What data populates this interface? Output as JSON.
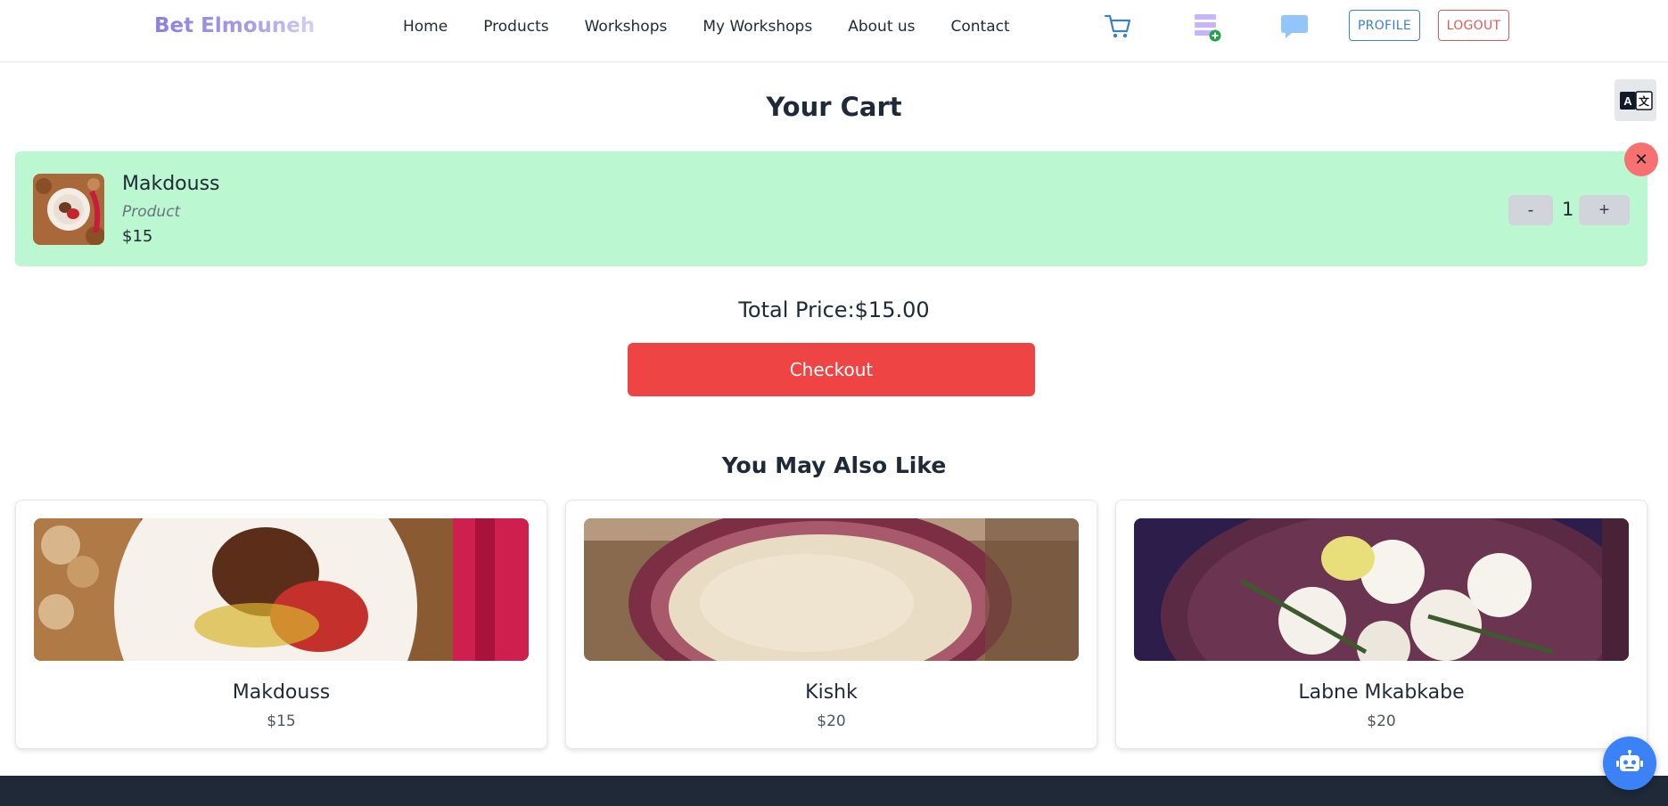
{
  "brand": "Bet Elmouneh",
  "nav": [
    "Home",
    "Products",
    "Workshops",
    "My Workshops",
    "About us",
    "Contact"
  ],
  "header_icons": {
    "cart": "cart-icon",
    "add_workshop": "list-add-icon",
    "chat": "chat-bubble-icon"
  },
  "profile_label": "PROFILE",
  "logout_label": "LOGOUT",
  "translate_icon": "translate-icon",
  "page_title": "Your Cart",
  "cart_item": {
    "name": "Makdouss",
    "type": "Product",
    "price": "$15",
    "quantity": "1",
    "minus_label": "-",
    "plus_label": "+",
    "remove_label": "✕"
  },
  "total": {
    "label": "Total Price:",
    "value": "$15.00"
  },
  "checkout_label": "Checkout",
  "recommendations_title": "You May Also Like",
  "recommendations": [
    {
      "name": "Makdouss",
      "price": "$15"
    },
    {
      "name": "Kishk",
      "price": "$20"
    },
    {
      "name": "Labne Mkabkabe",
      "price": "$20"
    }
  ],
  "colors": {
    "cart_item_bg": "#bbf7d0",
    "checkout": "#ef4444",
    "profile": "#3b82c4",
    "logout": "#e05a5a",
    "footer": "#1f2937",
    "chatbot": "#3b82f6"
  },
  "chatbot_icon": "robot-icon"
}
